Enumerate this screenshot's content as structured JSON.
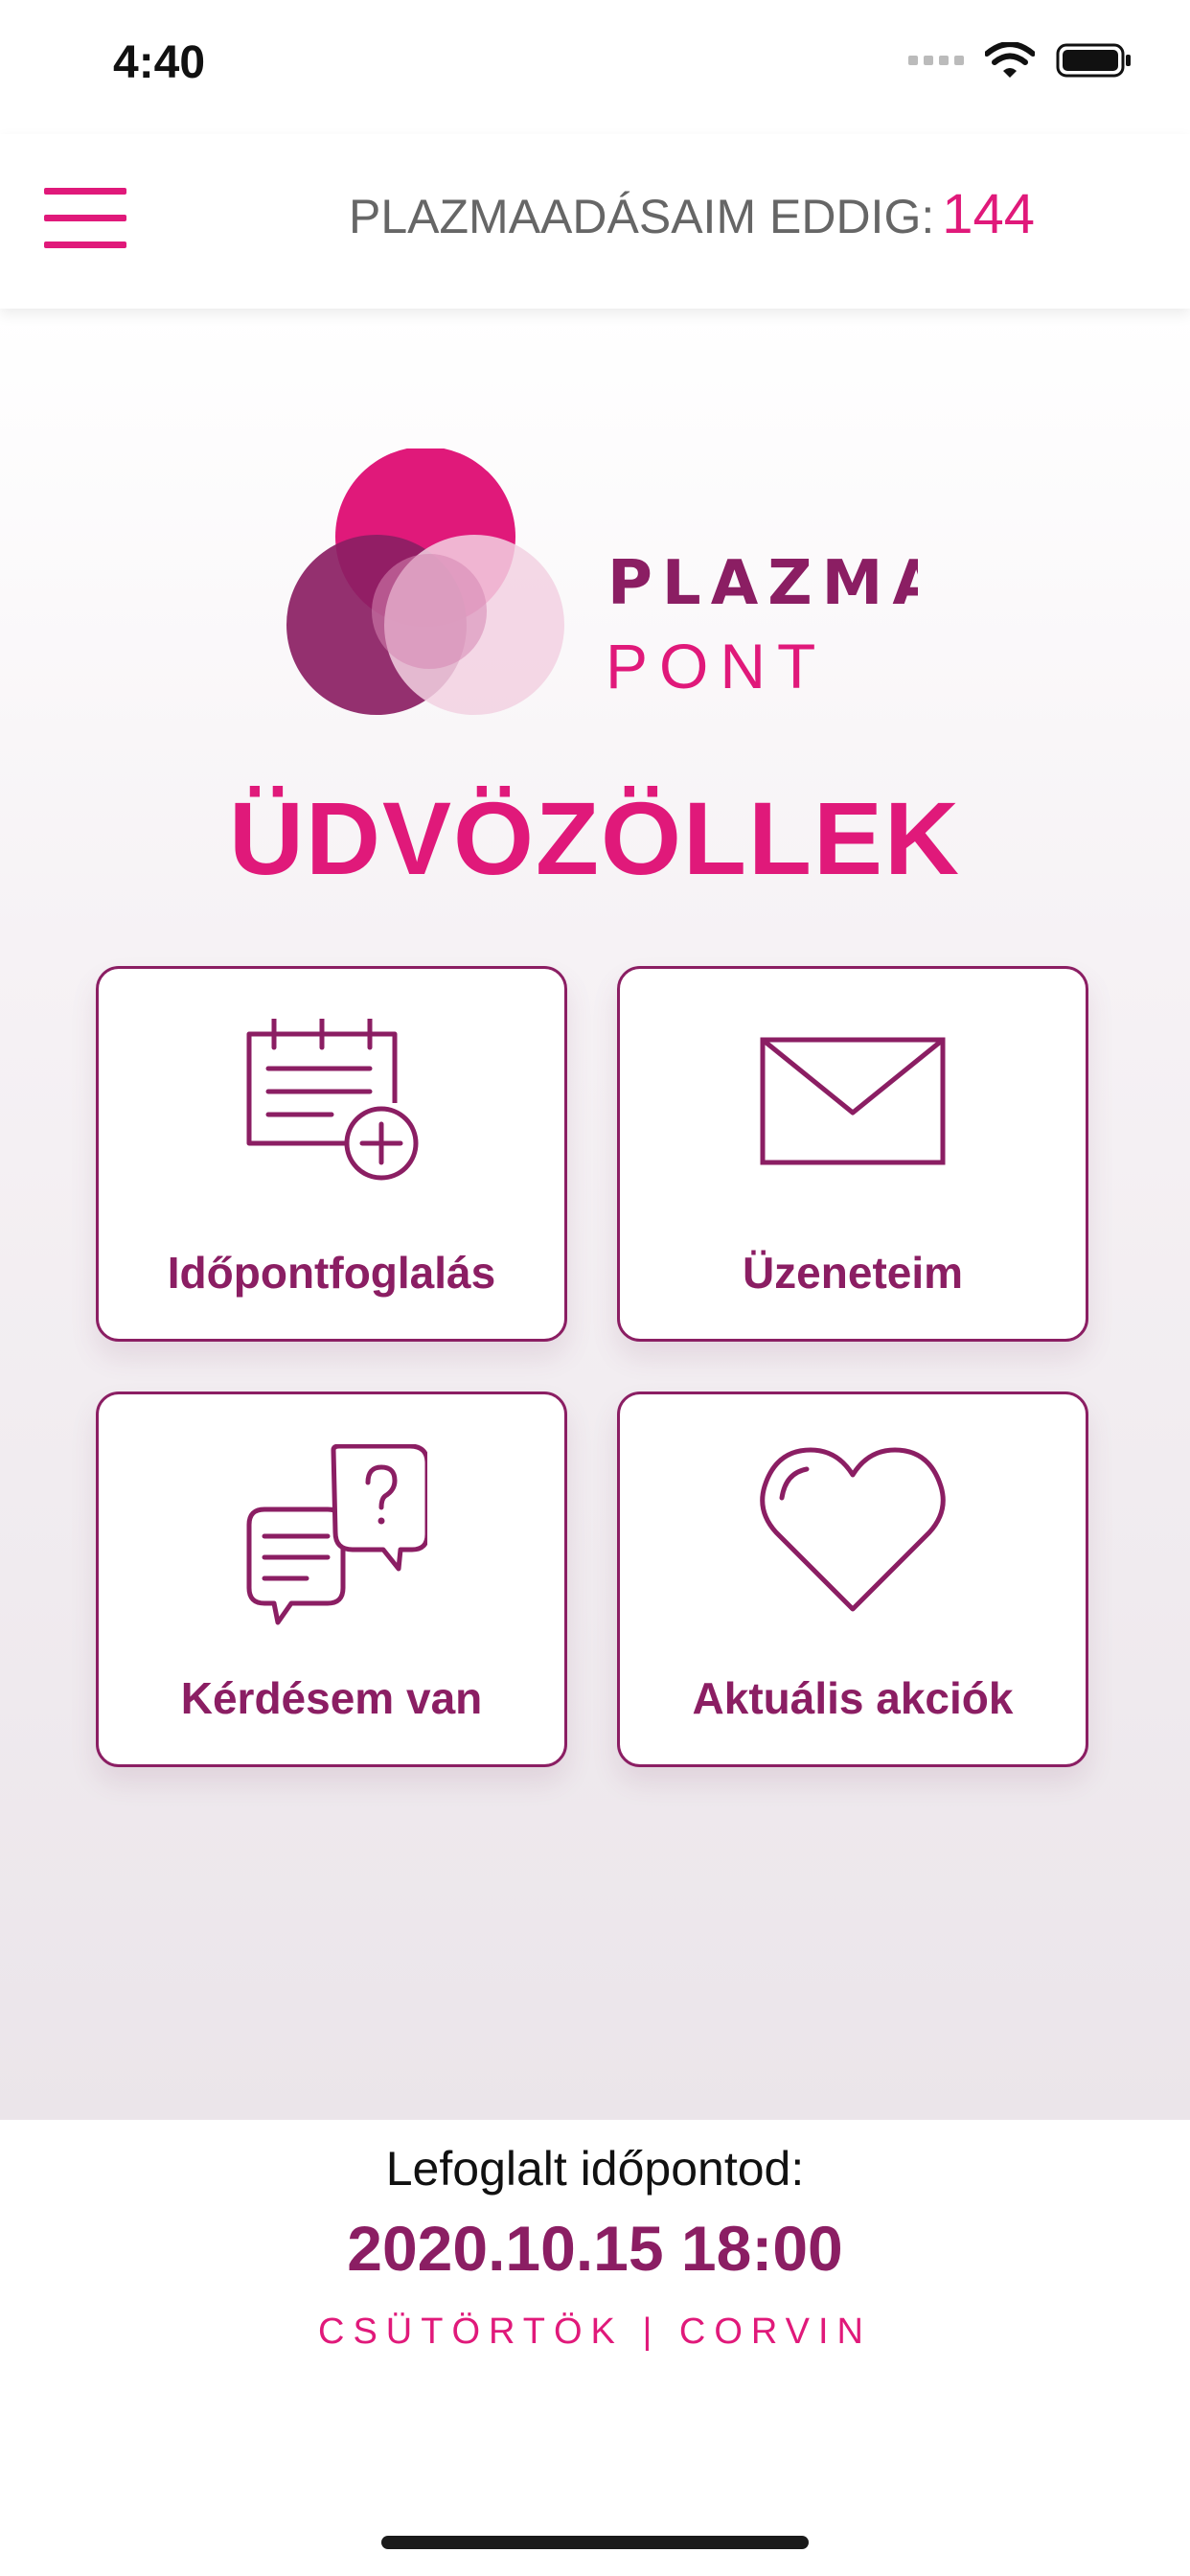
{
  "status_bar": {
    "time": "4:40"
  },
  "header": {
    "counter_label": "PLAZMAADÁSAIM EDDIG:",
    "counter_value": "144"
  },
  "logo": {
    "line1": "PLAZMA",
    "line2": "PONT"
  },
  "greeting": "ÜDVÖZÖLLEK",
  "tiles": [
    {
      "label": "Időpontfoglalás",
      "icon": "calendar-add-icon"
    },
    {
      "label": "Üzeneteim",
      "icon": "envelope-icon"
    },
    {
      "label": "Kérdésem van",
      "icon": "chat-question-icon"
    },
    {
      "label": "Aktuális akciók",
      "icon": "heart-icon"
    }
  ],
  "booking": {
    "label": "Lefoglalt időpontod:",
    "datetime": "2020.10.15 18:00",
    "meta": "CSÜTÖRTÖK | CORVIN"
  },
  "colors": {
    "primary": "#e0197a",
    "secondary": "#8b1e63"
  }
}
